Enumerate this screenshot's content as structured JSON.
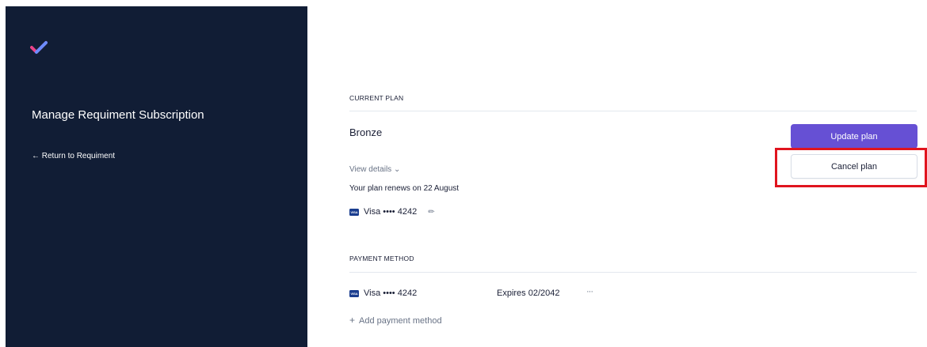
{
  "sidebar": {
    "title": "Manage Requiment Subscription",
    "return_link": "← Return to Requiment",
    "logo_icon": "checkmark-logo-icon"
  },
  "current_plan": {
    "section_label": "CURRENT PLAN",
    "plan_name": "Bronze",
    "view_details": "View details",
    "renews_text": "Your plan renews on 22 August",
    "update_button": "Update plan",
    "cancel_button": "Cancel plan",
    "card": {
      "brand_badge": "VISA",
      "label": "Visa •••• 4242"
    }
  },
  "payment_method": {
    "section_label": "PAYMENT METHOD",
    "card": {
      "brand_badge": "VISA",
      "label": "Visa •••• 4242",
      "expires": "Expires 02/2042",
      "more": "···"
    },
    "add_method": "Add payment method"
  },
  "colors": {
    "sidebar_bg": "#111d35",
    "accent_purple": "#6650d4",
    "highlight_red": "#e0141e"
  }
}
